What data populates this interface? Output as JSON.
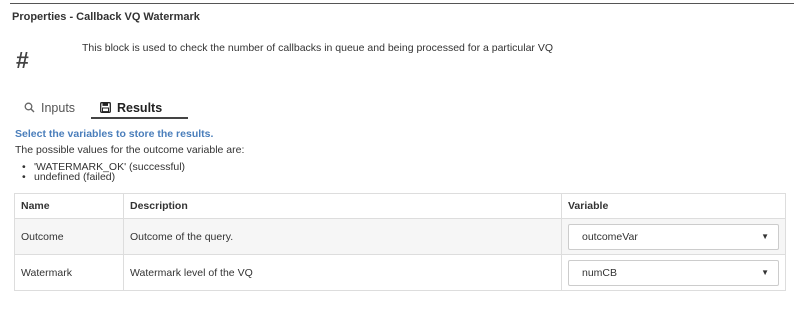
{
  "panel": {
    "title": "Properties - Callback VQ Watermark",
    "icon": "hash-icon",
    "icon_glyph": "#",
    "description": "This block is used to check the number of callbacks in queue and being processed for a particular VQ"
  },
  "tabs": [
    {
      "label": "Inputs",
      "icon": "search-icon",
      "active": false
    },
    {
      "label": "Results",
      "icon": "save-icon",
      "active": true
    }
  ],
  "results": {
    "select_hint": "Select the variables to store the results.",
    "outcome_intro": "The possible values for the outcome variable are:",
    "outcome_values": [
      "'WATERMARK_OK' (successful)",
      "undefined (failed)"
    ],
    "table": {
      "headers": [
        "Name",
        "Description",
        "Variable"
      ],
      "rows": [
        {
          "name": "Outcome",
          "description": "Outcome of the query.",
          "variable": "outcomeVar"
        },
        {
          "name": "Watermark",
          "description": "Watermark level of the VQ",
          "variable": "numCB"
        }
      ]
    },
    "dropdown_arrow": "▼"
  },
  "colors": {
    "accent": "#4a7ebb",
    "row_alt": "#f6f6f6",
    "border": "#dddddd"
  }
}
